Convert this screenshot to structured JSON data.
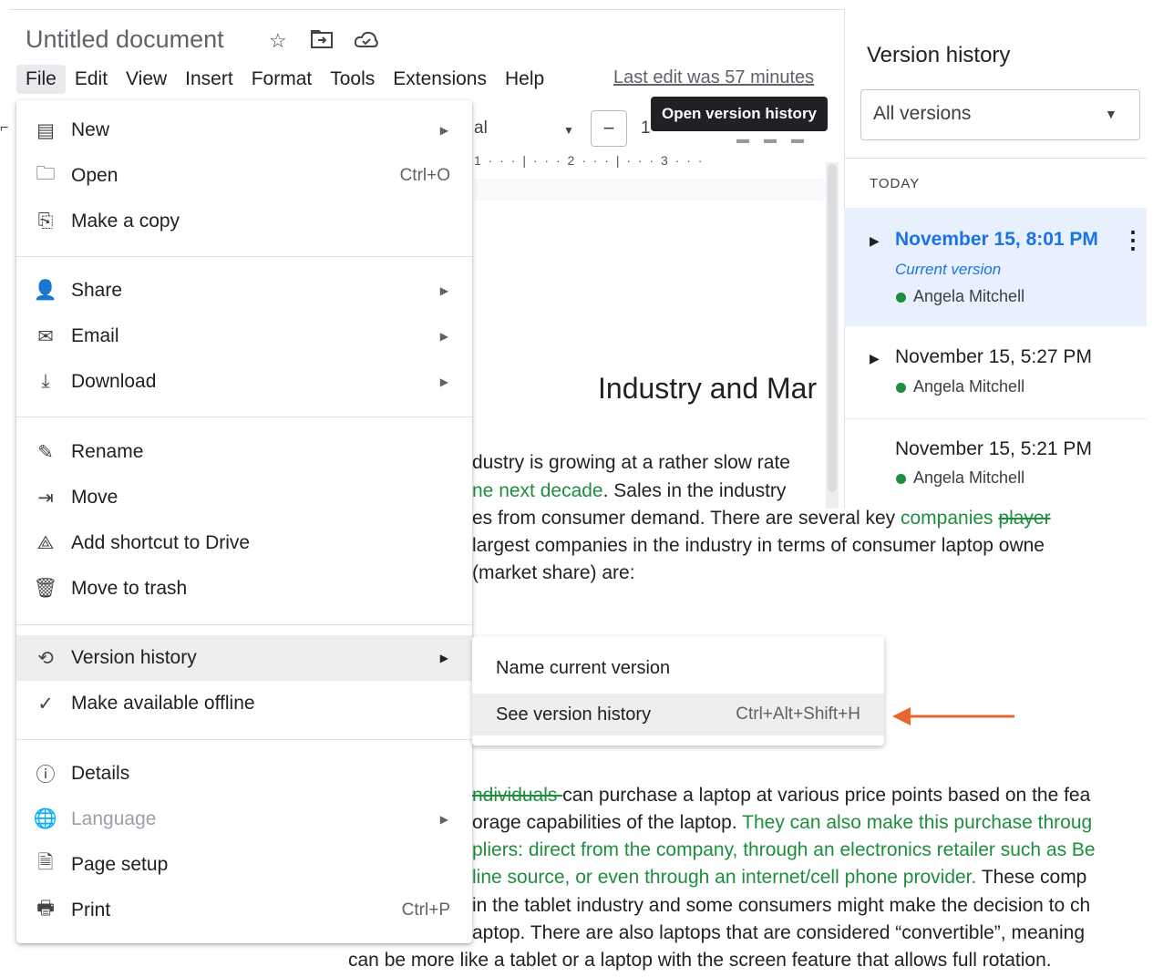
{
  "doc": {
    "title": "Untitled document",
    "icons": [
      "star-icon",
      "move-to-folder-icon",
      "cloud-status-icon"
    ]
  },
  "menubar": {
    "items": [
      "File",
      "Edit",
      "View",
      "Insert",
      "Format",
      "Tools",
      "Extensions",
      "Help"
    ],
    "last_edit": "Last edit was 57 minutes"
  },
  "tooltip": "Open version history",
  "toolbar": {
    "font_fragment": "al",
    "minus": "−",
    "size_fragment": "1"
  },
  "ruler": "1 · · · | · · · 2 · · · | · · · 3 · · ·",
  "document": {
    "heading": "Industry and Mar",
    "lines": [
      {
        "segments": [
          {
            "text": "dustry is growing at a rather slow rate",
            "style": ""
          }
        ]
      },
      {
        "segments": [
          {
            "text": "ne next decade",
            "style": "green"
          },
          {
            "text": ".  Sales in the industry",
            "style": ""
          }
        ]
      },
      {
        "segments": [
          {
            "text": "es from consumer demand. There are several key ",
            "style": ""
          },
          {
            "text": "companies ",
            "style": "green"
          },
          {
            "text": "player",
            "style": "green strike"
          }
        ]
      },
      {
        "segments": [
          {
            "text": " largest companies in the industry in terms of consumer laptop owne",
            "style": ""
          }
        ]
      },
      {
        "segments": [
          {
            "text": " (market share) are:",
            "style": ""
          }
        ]
      },
      {
        "segments": [
          {
            "text": "ndividuals ",
            "style": "green strike"
          },
          {
            "text": "can purchase a laptop at various price points based on the fea",
            "style": ""
          }
        ]
      },
      {
        "segments": [
          {
            "text": "orage capabilities of the laptop. ",
            "style": ""
          },
          {
            "text": "They can also make this purchase throug",
            "style": "green"
          }
        ]
      },
      {
        "segments": [
          {
            "text": "pliers: direct from the company, through an electronics retailer such as Be",
            "style": "green"
          }
        ]
      },
      {
        "segments": [
          {
            "text": "line source, or even through an internet/cell phone provider.",
            "style": "green"
          },
          {
            "text": "  These comp",
            "style": ""
          }
        ]
      },
      {
        "segments": [
          {
            "text": " in the tablet industry and some consumers might make the decision to ch",
            "style": ""
          }
        ]
      },
      {
        "segments": [
          {
            "text": "aptop.  There are also laptops that are considered “convertible”, meaning",
            "style": ""
          }
        ]
      },
      {
        "segments": [
          {
            "text": "can be more like a tablet or a laptop with the screen feature that allows full rotation.",
            "style": ""
          }
        ]
      }
    ]
  },
  "file_menu": {
    "items": [
      {
        "label": "New",
        "icon": "new-doc-icon",
        "arrow": true,
        "shortcut": ""
      },
      {
        "label": "Open",
        "icon": "folder-icon",
        "arrow": false,
        "shortcut": "Ctrl+O"
      },
      {
        "label": "Make a copy",
        "icon": "copy-icon",
        "arrow": false,
        "shortcut": ""
      },
      {
        "label": "Share",
        "icon": "share-person-icon",
        "arrow": true,
        "shortcut": ""
      },
      {
        "label": "Email",
        "icon": "mail-icon",
        "arrow": true,
        "shortcut": ""
      },
      {
        "label": "Download",
        "icon": "download-icon",
        "arrow": true,
        "shortcut": ""
      },
      {
        "label": "Rename",
        "icon": "rename-icon",
        "arrow": false,
        "shortcut": ""
      },
      {
        "label": "Move",
        "icon": "move-icon",
        "arrow": false,
        "shortcut": ""
      },
      {
        "label": "Add shortcut to Drive",
        "icon": "drive-shortcut-icon",
        "arrow": false,
        "shortcut": ""
      },
      {
        "label": "Move to trash",
        "icon": "trash-icon",
        "arrow": false,
        "shortcut": ""
      },
      {
        "label": "Version history",
        "icon": "history-icon",
        "arrow": true,
        "shortcut": "",
        "highlighted": true
      },
      {
        "label": "Make available offline",
        "icon": "offline-icon",
        "arrow": false,
        "shortcut": ""
      },
      {
        "label": "Details",
        "icon": "info-icon",
        "arrow": false,
        "shortcut": ""
      },
      {
        "label": "Language",
        "icon": "globe-icon",
        "arrow": true,
        "shortcut": "",
        "disabled": true
      },
      {
        "label": "Page setup",
        "icon": "page-setup-icon",
        "arrow": false,
        "shortcut": ""
      },
      {
        "label": "Print",
        "icon": "print-icon",
        "arrow": false,
        "shortcut": "Ctrl+P"
      }
    ]
  },
  "version_submenu": {
    "items": [
      {
        "label": "Name current version",
        "shortcut": ""
      },
      {
        "label": "See version history",
        "shortcut": "Ctrl+Alt+Shift+H",
        "highlighted": true
      }
    ]
  },
  "annotation": {
    "color": "#e8662e"
  },
  "version_panel": {
    "title": "Version history",
    "filter": "All versions",
    "section": "TODAY",
    "entries": [
      {
        "date": "November 15, 8:01 PM",
        "current_label": "Current version",
        "author": "Angela Mitchell",
        "selected": true,
        "expandable": true
      },
      {
        "date": "November 15, 5:27 PM",
        "current_label": "",
        "author": "Angela Mitchell",
        "selected": false,
        "expandable": true
      },
      {
        "date": "November 15, 5:21 PM",
        "current_label": "",
        "author": "Angela Mitchell",
        "selected": false,
        "expandable": false
      }
    ]
  }
}
